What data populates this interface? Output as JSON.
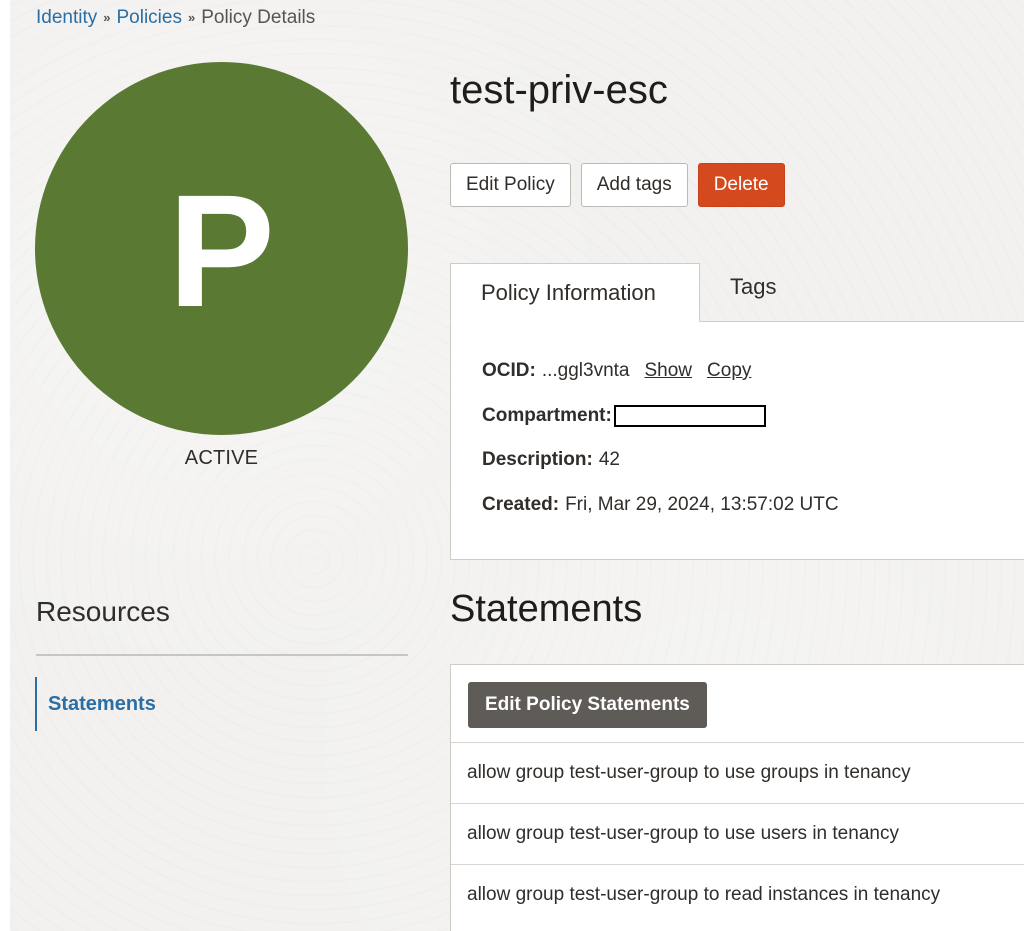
{
  "breadcrumb": {
    "items": [
      "Identity",
      "Policies"
    ],
    "current": "Policy Details",
    "separator": "»"
  },
  "avatar": {
    "letter": "P",
    "color": "#5a7a34"
  },
  "status": "ACTIVE",
  "policy": {
    "name": "test-priv-esc"
  },
  "actions": {
    "edit": "Edit Policy",
    "add_tags": "Add tags",
    "delete": "Delete",
    "danger_color": "#d4491e"
  },
  "tabs": [
    {
      "label": "Policy Information",
      "active": true
    },
    {
      "label": "Tags",
      "active": false
    }
  ],
  "info": {
    "ocid_label": "OCID:",
    "ocid_value": "...ggl3vnta",
    "show_link": "Show",
    "copy_link": "Copy",
    "compartment_label": "Compartment:",
    "description_label": "Description:",
    "description_value": "42",
    "created_label": "Created:",
    "created_value": "Fri, Mar 29, 2024, 13:57:02 UTC"
  },
  "resources": {
    "title": "Resources",
    "items": [
      "Statements"
    ]
  },
  "statements": {
    "title": "Statements",
    "edit_button": "Edit Policy Statements",
    "rows": [
      "allow group test-user-group to use groups in tenancy",
      "allow group test-user-group to use users in tenancy",
      "allow group test-user-group to read instances in tenancy"
    ]
  }
}
